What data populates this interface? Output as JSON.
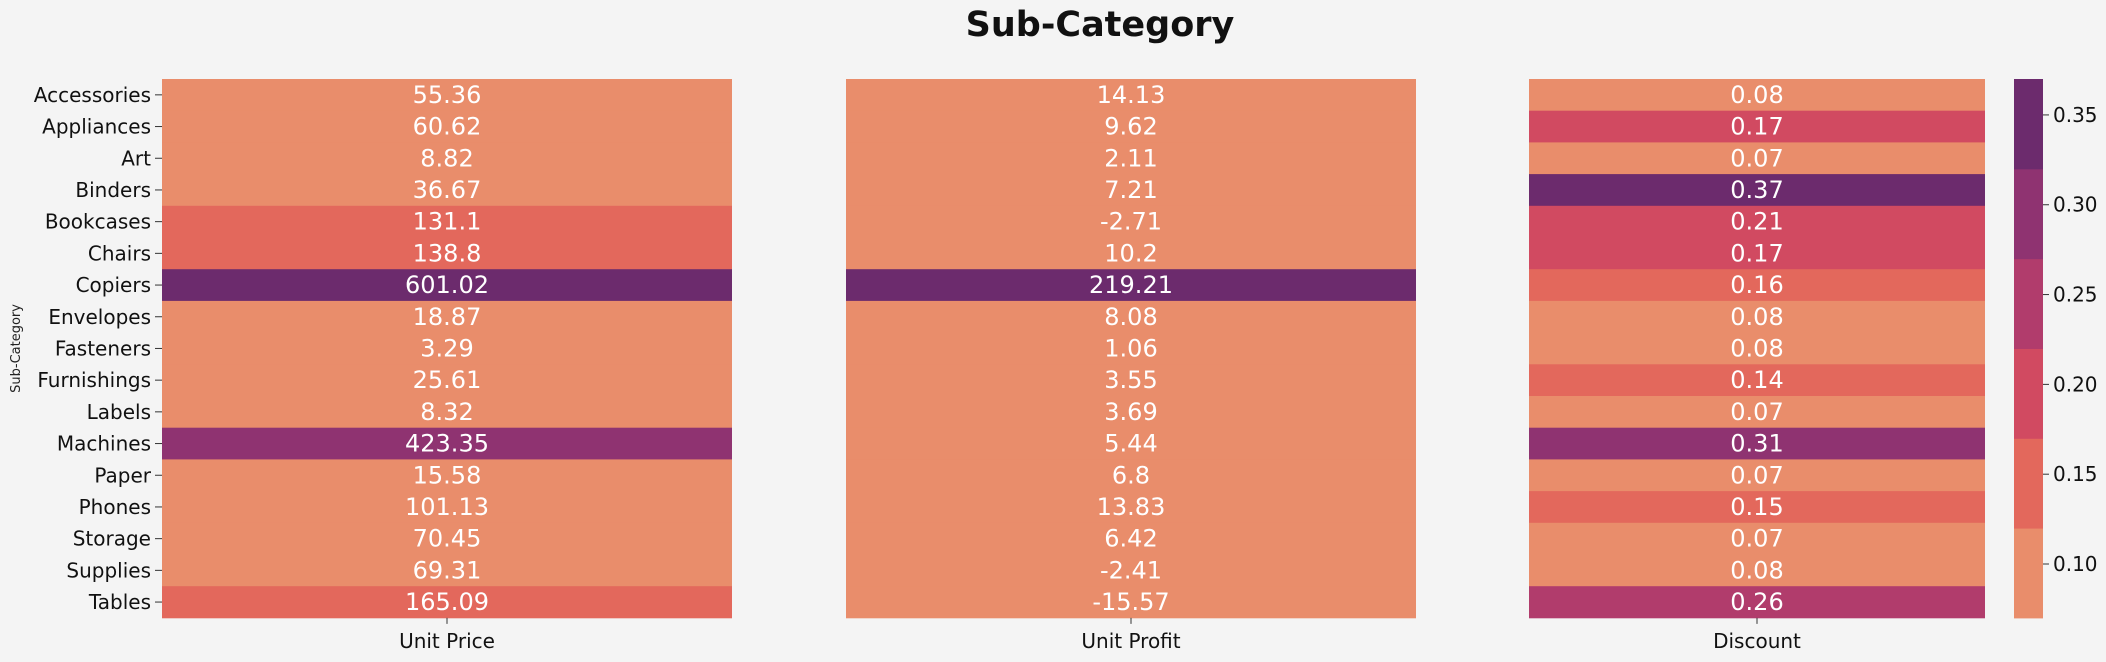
{
  "chart_data": {
    "type": "heatmap",
    "title": "Sub-Category",
    "ylabel": "Sub-Category",
    "rows": [
      "Accessories",
      "Appliances",
      "Art",
      "Binders",
      "Bookcases",
      "Chairs",
      "Copiers",
      "Envelopes",
      "Fasteners",
      "Furnishings",
      "Labels",
      "Machines",
      "Paper",
      "Phones",
      "Storage",
      "Supplies",
      "Tables"
    ],
    "columns": [
      "Unit Price",
      "Unit Profit",
      "Discount"
    ],
    "values": {
      "Unit Price": [
        55.36,
        60.62,
        8.82,
        36.67,
        131.1,
        138.8,
        601.02,
        18.87,
        3.29,
        25.61,
        8.32,
        423.35,
        15.58,
        101.13,
        70.45,
        69.31,
        165.09
      ],
      "Unit Profit": [
        14.13,
        9.62,
        2.11,
        7.21,
        -2.71,
        10.2,
        219.21,
        8.08,
        1.06,
        3.55,
        3.69,
        5.44,
        6.8,
        13.83,
        6.42,
        -2.41,
        -15.57
      ],
      "Discount": [
        0.08,
        0.17,
        0.07,
        0.37,
        0.21,
        0.17,
        0.16,
        0.08,
        0.08,
        0.14,
        0.07,
        0.31,
        0.07,
        0.15,
        0.07,
        0.08,
        0.26
      ]
    },
    "colorbar": {
      "attached_to": "Discount",
      "range": [
        0.07,
        0.37
      ],
      "ticks": [
        "0.10",
        "0.15",
        "0.20",
        "0.25",
        "0.30",
        "0.35"
      ],
      "palette": [
        "#e98d6b",
        "#e3685c",
        "#d14a61",
        "#b13c6c",
        "#8f3371",
        "#6c2b6d"
      ]
    },
    "cell_text_color": "#ffffff",
    "background": "#f4f4f4",
    "grid": false,
    "legend": "colorbar-right"
  }
}
